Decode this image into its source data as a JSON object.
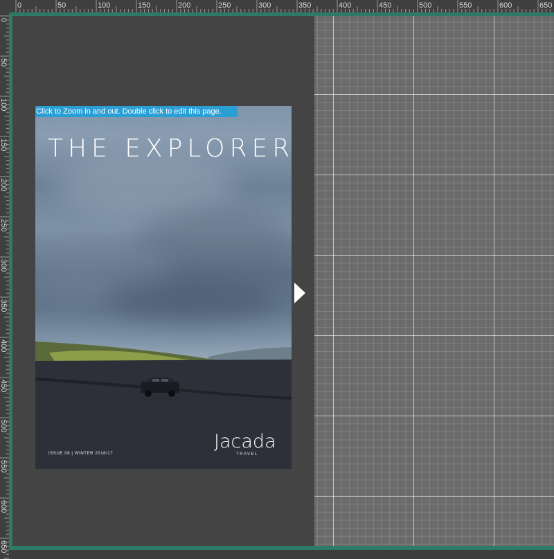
{
  "ruler": {
    "top_labels": [
      "0",
      "50",
      "100",
      "150",
      "200",
      "250",
      "300",
      "350",
      "400",
      "450",
      "500",
      "550",
      "600",
      "650"
    ],
    "left_labels": [
      "0",
      "50",
      "100",
      "150",
      "200",
      "250",
      "300",
      "350",
      "400",
      "450",
      "500",
      "550",
      "600",
      "650"
    ]
  },
  "viewer": {
    "hint": "Click to Zoom in and out. Double click to edit this page."
  },
  "cover": {
    "title": "THE EXPLORER",
    "issue": "ISSUE 06 | WINTER 2016/17",
    "brand": "Jacada",
    "brand_sub": "TRAVEL"
  },
  "colors": {
    "frame_border": "#2d7a66",
    "hint_background": "#2a9fd6",
    "grid_background": "#6b6b6b"
  },
  "icons": {
    "next_page": "triangle-right"
  }
}
